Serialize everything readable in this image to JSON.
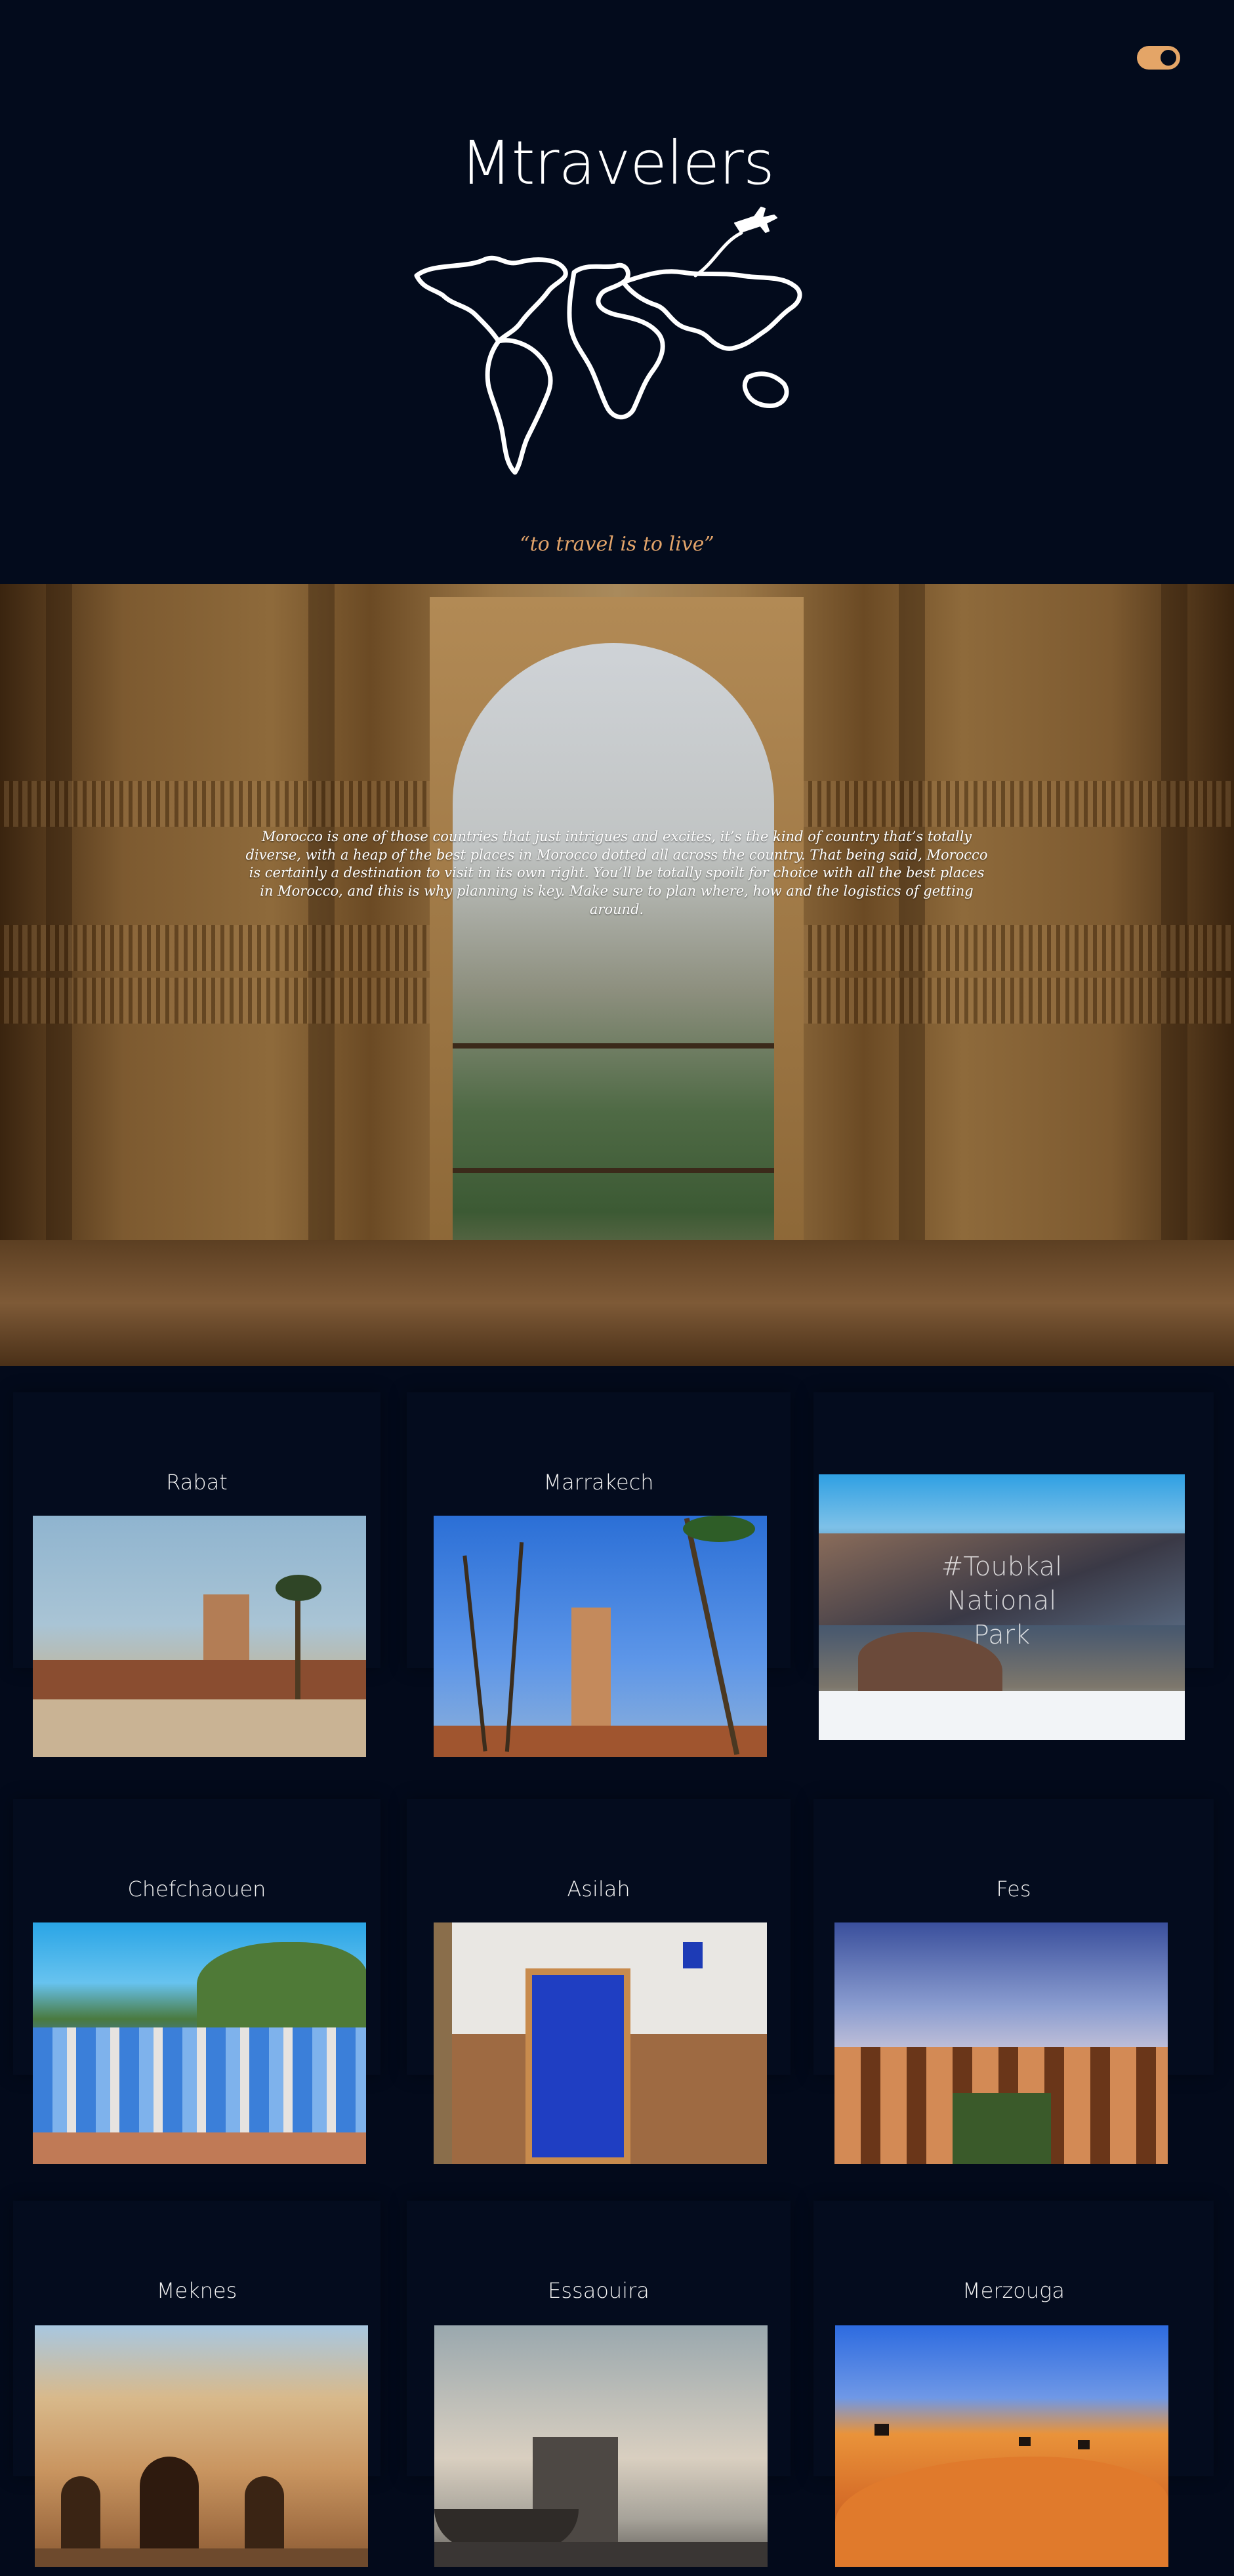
{
  "header": {
    "site_title": "Mtravelers",
    "tagline": "“to travel is to live”",
    "theme_toggle": {
      "state": "on"
    }
  },
  "hero": {
    "paragraph": "Morocco is one of those countries that just intrigues and excites, it’s the kind of country that’s totally diverse, with a heap of the best places in Morocco dotted all across the country. That being said, Morocco is certainly a destination to visit in its own right. You’ll be totally spoilt for choice with all the best places in Morocco, and this is why planning is key. Make sure to plan where, how and the logistics of getting around."
  },
  "destinations": [
    {
      "name": "Rabat"
    },
    {
      "name": "Marrakech"
    },
    {
      "name": "#Toubkal National Park",
      "overlay_lines": [
        "#Toubkal",
        "National",
        "Park"
      ]
    },
    {
      "name": "Chefchaouen"
    },
    {
      "name": "Asilah"
    },
    {
      "name": "Fes"
    },
    {
      "name": "Meknes"
    },
    {
      "name": "Essaouira"
    },
    {
      "name": "Merzouga"
    }
  ],
  "colors": {
    "background": "#030a1b",
    "accent": "#e3a46a"
  }
}
